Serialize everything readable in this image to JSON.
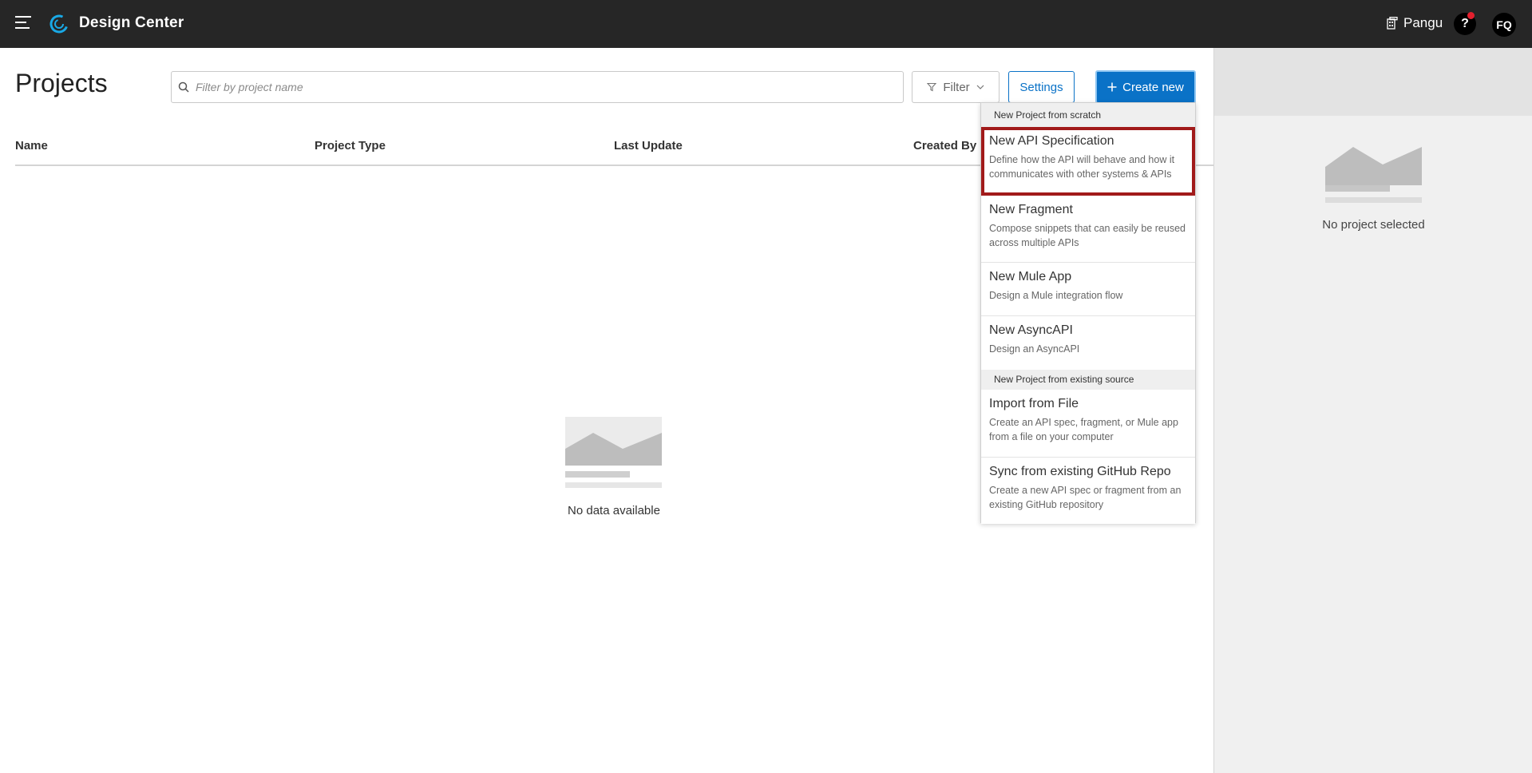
{
  "app": {
    "title": "Design Center"
  },
  "topbar": {
    "org_name": "Pangu",
    "help_label": "?",
    "user_initials": "FQ"
  },
  "page": {
    "title": "Projects"
  },
  "search": {
    "placeholder": "Filter by project name",
    "value": ""
  },
  "toolbar": {
    "filter_label": "Filter",
    "settings_label": "Settings",
    "create_label": "Create new"
  },
  "table": {
    "columns": [
      "Name",
      "Project Type",
      "Last Update",
      "Created By"
    ]
  },
  "empty_state": {
    "text": "No data available"
  },
  "right_panel": {
    "empty_text": "No project selected"
  },
  "dropdown": {
    "sections": [
      {
        "header": "New Project from scratch",
        "items": [
          {
            "title": "New API Specification",
            "description": "Define how the API will behave and how it communicates with other systems & APIs",
            "selected": true
          },
          {
            "title": "New Fragment",
            "description": "Compose snippets that can easily be reused across multiple APIs",
            "selected": false
          },
          {
            "title": "New Mule App",
            "description": "Design a Mule integration flow",
            "selected": false
          },
          {
            "title": "New AsyncAPI",
            "description": "Design an AsyncAPI",
            "selected": false
          }
        ]
      },
      {
        "header": "New Project from existing source",
        "items": [
          {
            "title": "Import from File",
            "description": "Create an API spec, fragment, or Mule app from a file on your computer",
            "selected": false
          },
          {
            "title": "Sync from existing GitHub Repo",
            "description": "Create a new API spec or fragment from an existing GitHub repository",
            "selected": false
          }
        ]
      }
    ]
  },
  "colors": {
    "topbar_bg": "#262626",
    "accent": "#0a72c7",
    "selection_outline": "#a11a1a",
    "notification_dot": "#e4202e"
  },
  "icons": {
    "menu": "hamburger-icon",
    "logo": "design-center-logo-icon",
    "org": "organization-icon",
    "search": "search-icon",
    "filter": "funnel-icon",
    "plus": "plus-icon",
    "chevron": "chevron-down-icon"
  }
}
